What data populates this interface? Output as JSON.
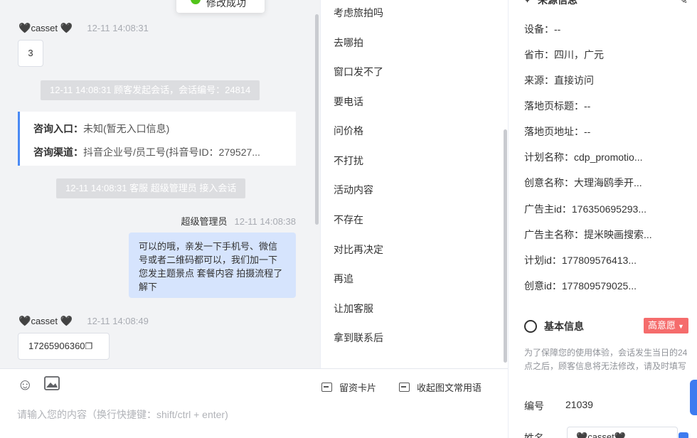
{
  "toast": {
    "text": "修改成功"
  },
  "chat": {
    "messages": [
      {
        "sender": "casset",
        "time": "12-11 14:08:31",
        "text": "3"
      },
      {
        "sender": "casset",
        "time": "12-11 14:08:49",
        "text": "17265906360"
      }
    ],
    "system_start": "12-11 14:08:31 顾客发起会话，会话编号：24814",
    "system_join": "12-11 14:08:31 客服 超级管理员 接入会话",
    "entry_card": {
      "entry_label": "咨询入口：",
      "entry_value": "未知(暂无入口信息)",
      "channel_label": "咨询渠道：",
      "channel_value": "抖音企业号/员工号(抖音号ID：279527..."
    },
    "agent": {
      "name": "超级管理员",
      "time": "12-11 14:08:38",
      "text": "可以的哦，亲发一下手机号、微信号或者二维码都可以，我们加一下您发主题景点 套餐内容 拍摄流程了解下"
    }
  },
  "input": {
    "placeholder": "请输入您的内容（换行快捷键：shift/ctrl + enter)",
    "card_button": "留资卡片",
    "collapse_button": "收起图文常用语"
  },
  "quick_replies": [
    "考虑旅拍吗",
    "去哪拍",
    "窗口发不了",
    "要电话",
    "问价格",
    "不打扰",
    "活动内容",
    "不存在",
    "对比再决定",
    "再追",
    "让加客服",
    "拿到联系后"
  ],
  "info": {
    "source_title": "来源信息",
    "rows": [
      "设备：--",
      "省市：四川，广元",
      "来源：直接访问",
      "落地页标题：--",
      "落地页地址：--",
      "计划名称：cdp_promotio...",
      "创意名称：大理海鸥季开...",
      "广告主id：176350695293...",
      "广告主名称：提米映画搜索...",
      "计划id：177809576413...",
      "创意id：177809579025..."
    ],
    "basic_title": "基本信息",
    "intent_badge": "高意愿",
    "notice": "为了保障您的使用体验，会话发生当日的24点之后，顾客信息将无法修改，请及时填写",
    "id_label": "编号",
    "id_value": "21039",
    "name_label": "姓名",
    "name_value": "casset"
  }
}
